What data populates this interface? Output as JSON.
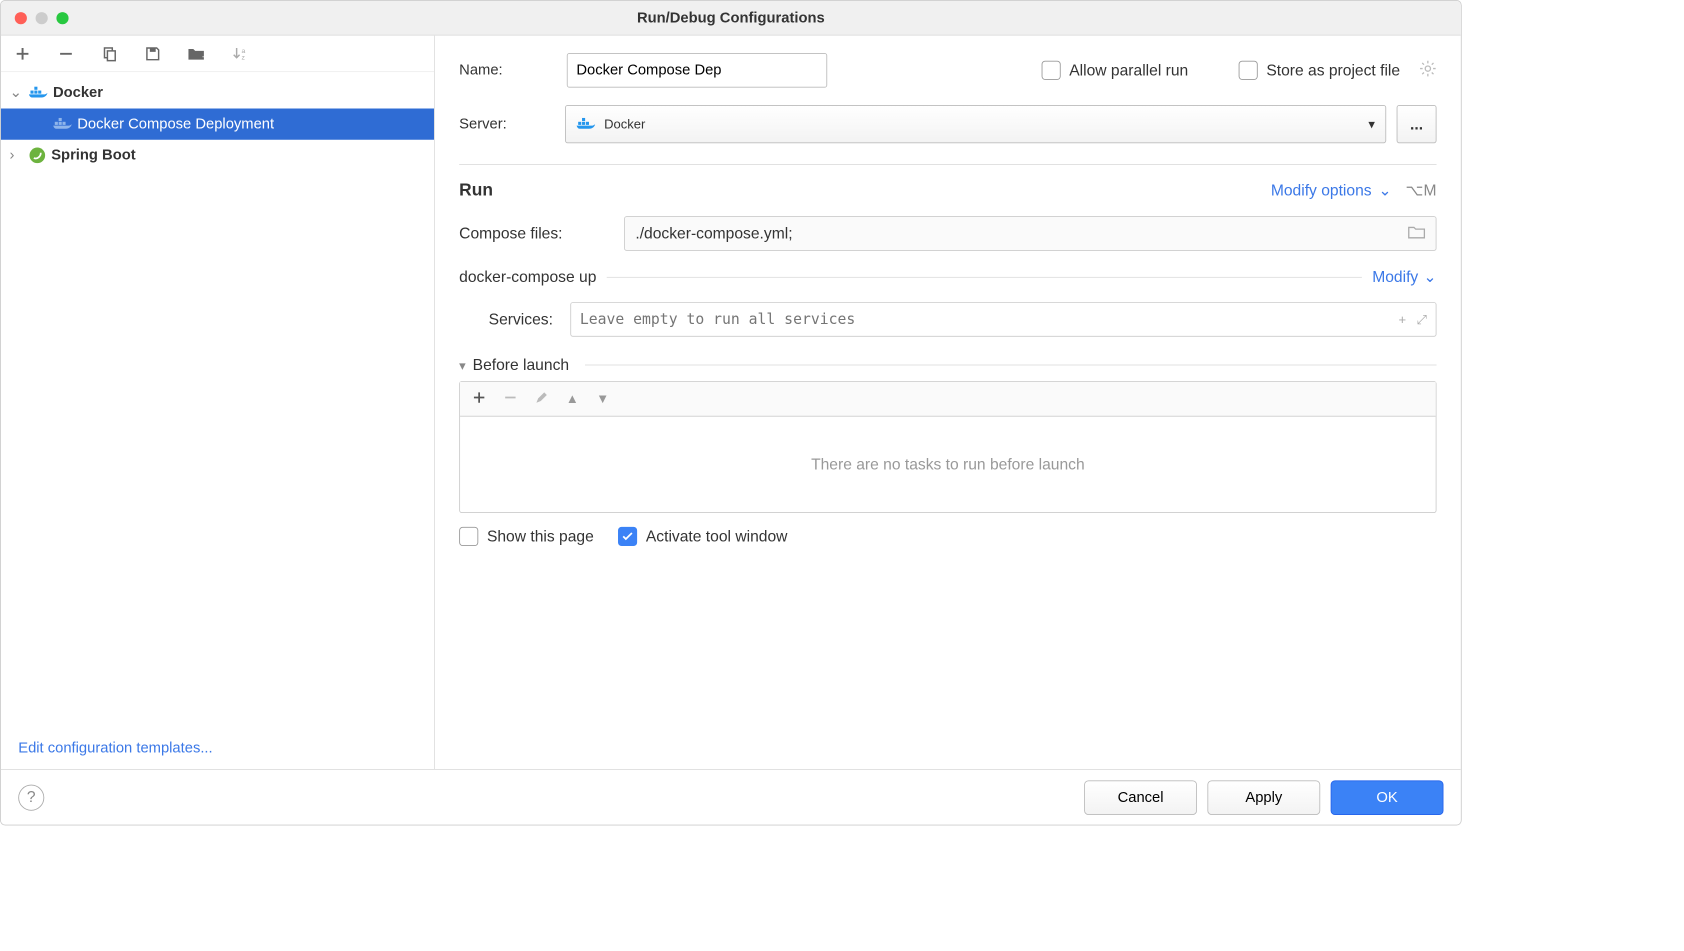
{
  "window": {
    "title": "Run/Debug Configurations"
  },
  "sidebar": {
    "docker_label": "Docker",
    "docker_compose_label": "Docker Compose Deployment",
    "spring_label": "Spring Boot",
    "edit_templates": "Edit configuration templates..."
  },
  "form": {
    "name_label": "Name:",
    "name_value": "Docker Compose Dep",
    "allow_parallel": "Allow parallel run",
    "store_project": "Store as project file",
    "server_label": "Server:",
    "server_value": "Docker",
    "run_header": "Run",
    "modify_options": "Modify options",
    "shortcut": "⌥M",
    "compose_files_label": "Compose files:",
    "compose_files_value": "./docker-compose.yml;",
    "docker_up_label": "docker-compose up",
    "modify": "Modify",
    "services_label": "Services:",
    "services_placeholder": "Leave empty to run all services",
    "before_launch": "Before launch",
    "tasks_empty": "There are no tasks to run before launch",
    "show_page": "Show this page",
    "activate_tool": "Activate tool window"
  },
  "footer": {
    "cancel": "Cancel",
    "apply": "Apply",
    "ok": "OK"
  }
}
